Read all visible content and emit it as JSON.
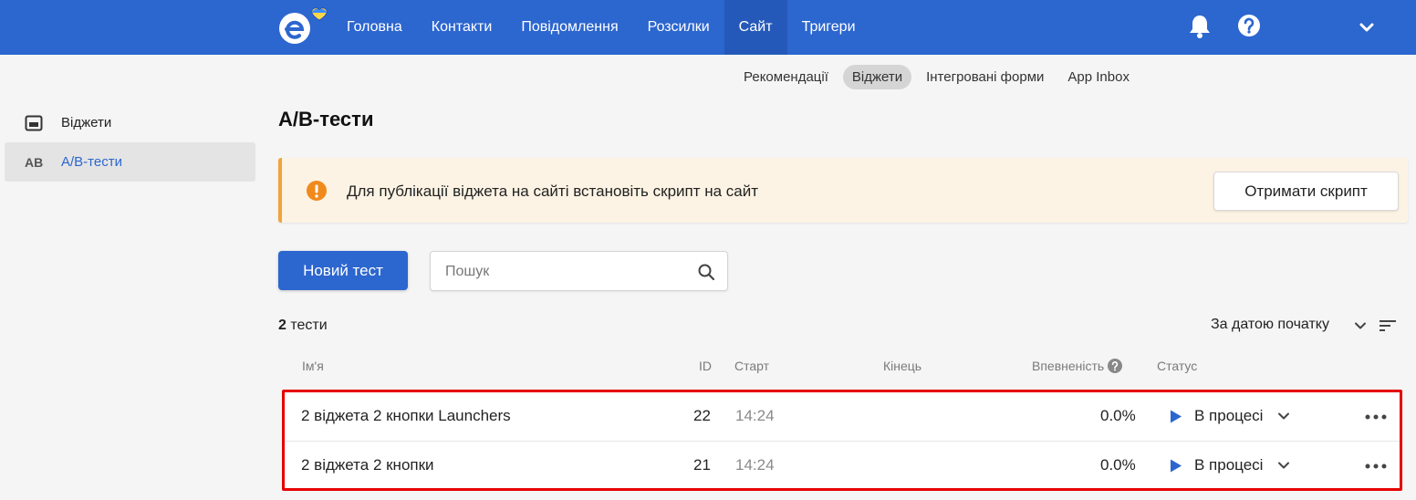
{
  "colors": {
    "brand": "#2c66cf",
    "navActive": "#2559b9",
    "warning": "#f0a43a",
    "highlightBorder": "#e60000"
  },
  "topnav": {
    "items": [
      {
        "label": "Головна"
      },
      {
        "label": "Контакти"
      },
      {
        "label": "Повідомлення"
      },
      {
        "label": "Розсилки"
      },
      {
        "label": "Сайт",
        "active": true
      },
      {
        "label": "Тригери"
      }
    ],
    "icons": [
      "logo-icon",
      "bell-icon",
      "help-icon",
      "chevron-down-icon"
    ]
  },
  "subtabs": [
    {
      "label": "Рекомендації"
    },
    {
      "label": "Віджети",
      "active": true
    },
    {
      "label": "Інтегровані форми"
    },
    {
      "label": "App Inbox"
    }
  ],
  "sidebar": {
    "items": [
      {
        "label": "Віджети",
        "icon": "widget-icon"
      },
      {
        "label": "A/B-тести",
        "badge": "AB",
        "active": true
      }
    ]
  },
  "page": {
    "title": "A/B-тести",
    "notice": {
      "text": "Для публікації віджета на сайті встановіть скрипт на сайт",
      "button": "Отримати скрипт"
    },
    "new_button": "Новий тест",
    "search": {
      "placeholder": "Пошук",
      "value": ""
    },
    "count_number": "2",
    "count_word": "тести",
    "sort_label": "За датою початку"
  },
  "table": {
    "headers": {
      "name": "Ім'я",
      "id": "ID",
      "start": "Старт",
      "end": "Кінець",
      "confidence": "Впевненість",
      "status": "Статус"
    },
    "rows": [
      {
        "name": "2 віджета 2 кнопки Launchers",
        "id": "22",
        "start": "14:24",
        "end": "",
        "confidence": "0.0%",
        "status": "В процесі"
      },
      {
        "name": "2 віджета 2 кнопки",
        "id": "21",
        "start": "14:24",
        "end": "",
        "confidence": "0.0%",
        "status": "В процесі"
      }
    ]
  }
}
